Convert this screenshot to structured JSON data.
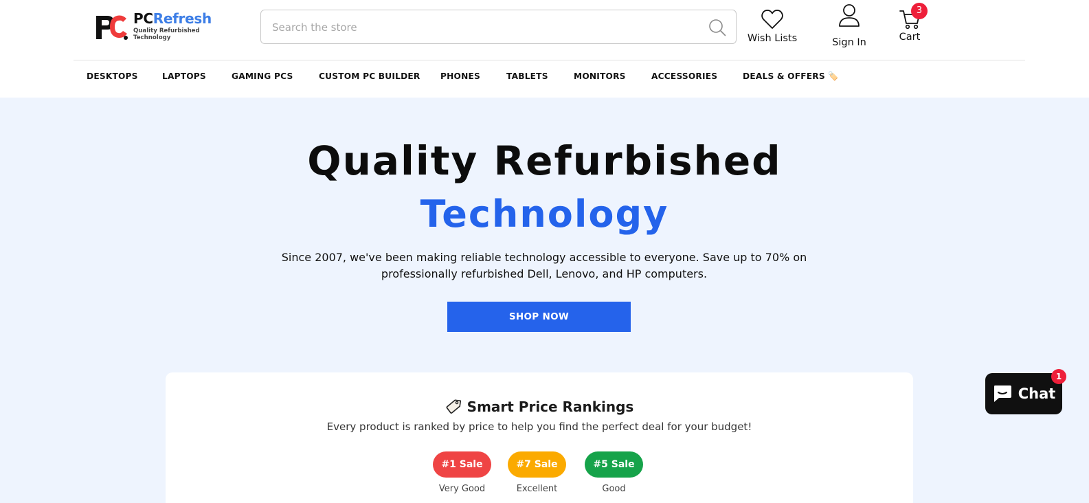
{
  "header": {
    "logo": {
      "name_part1": "PC",
      "name_part2": "Refresh",
      "tagline": "Quality Refurbished Technology"
    },
    "search": {
      "placeholder": "Search the store",
      "value": ""
    },
    "wishlist_label": "Wish Lists",
    "signin_label": "Sign In",
    "cart_label": "Cart",
    "cart_count": "3"
  },
  "nav": {
    "items": [
      {
        "label": "DESKTOPS"
      },
      {
        "label": "LAPTOPS"
      },
      {
        "label": "GAMING PCS"
      },
      {
        "label": "CUSTOM PC BUILDER"
      },
      {
        "label": "PHONES"
      },
      {
        "label": "TABLETS"
      },
      {
        "label": "MONITORS"
      },
      {
        "label": "ACCESSORIES"
      },
      {
        "label": "DEALS & OFFERS 🏷️"
      }
    ]
  },
  "hero": {
    "title_line1": "Quality Refurbished",
    "title_line2": "Technology",
    "subtitle": "Since 2007, we've been making reliable technology accessible to everyone. Save up to 70% on professionally refurbished Dell, Lenovo, and HP computers.",
    "cta_label": "SHOP NOW"
  },
  "rankings": {
    "title": "Smart Price Rankings",
    "subtitle": "Every product is ranked by price to help you find the perfect deal for your budget!",
    "items": [
      {
        "badge": "#1 Sale",
        "label": "Very Good",
        "color": "#ef4444"
      },
      {
        "badge": "#7 Sale",
        "label": "Excellent",
        "color": "#fbaa00"
      },
      {
        "badge": "#5 Sale",
        "label": "Good",
        "color": "#16a34a"
      }
    ]
  },
  "chat": {
    "label": "Chat",
    "badge": "1"
  },
  "colors": {
    "accent": "#2563eb",
    "hero_bg": "#eef4fe",
    "badge_red": "#ee1f3a"
  }
}
